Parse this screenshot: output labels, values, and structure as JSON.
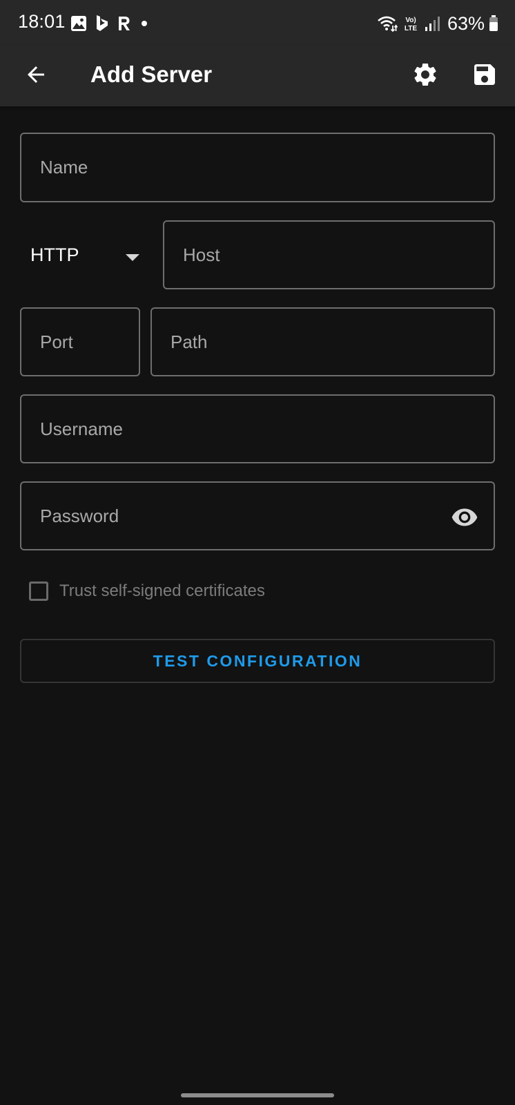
{
  "status_bar": {
    "time": "18:01",
    "battery": "63%",
    "notification_icons": [
      "gallery-icon",
      "bing-icon",
      "r-app-icon",
      "dot-icon"
    ],
    "system_icons": [
      "wifi-icon",
      "volte-icon",
      "signal-icon",
      "battery-icon"
    ]
  },
  "app_bar": {
    "title": "Add Server",
    "icons": [
      "back-arrow-icon",
      "gear-icon",
      "save-icon"
    ]
  },
  "form": {
    "name_placeholder": "Name",
    "protocol": "HTTP",
    "host_placeholder": "Host",
    "port_placeholder": "Port",
    "path_placeholder": "Path",
    "username_placeholder": "Username",
    "password_placeholder": "Password",
    "trust_label": "Trust self-signed certificates",
    "trust_checked": false,
    "test_button": "TEST CONFIGURATION"
  },
  "colors": {
    "background": "#121212",
    "app_bar": "#282828",
    "accent": "#1f9bea",
    "field_border": "#6e6e6e"
  }
}
